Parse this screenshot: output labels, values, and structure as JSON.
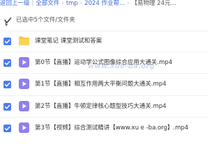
{
  "breadcrumb": {
    "back": "返回上一级",
    "items": [
      "全部文件",
      "tmp",
      "2024 作业帮..."
    ],
    "current": "【易物理 24元..."
  },
  "selection": {
    "text": "已选中5个文件/文件夹"
  },
  "files": [
    {
      "name": "课堂笔记 课堂测试和答案",
      "type": "folder"
    },
    {
      "name": "第0节【直播】运动学公式图像综合应用大通关.mp4",
      "type": "video"
    },
    {
      "name": "第1节【直播】相互作用两大平衡问题大通关.mp4",
      "type": "video"
    },
    {
      "name": "第2节【直播】牛顿定律核心题型技巧大通关.mp4",
      "type": "video"
    },
    {
      "name": "第3节【视频】综合测试精讲【www.xu e -ba.org】.mp4",
      "type": "video"
    }
  ],
  "watermark": "www.xue-ba.org",
  "colors": {
    "accent": "#4a7cf0",
    "folder": "#f6c742",
    "video": "#8e7ff1"
  }
}
